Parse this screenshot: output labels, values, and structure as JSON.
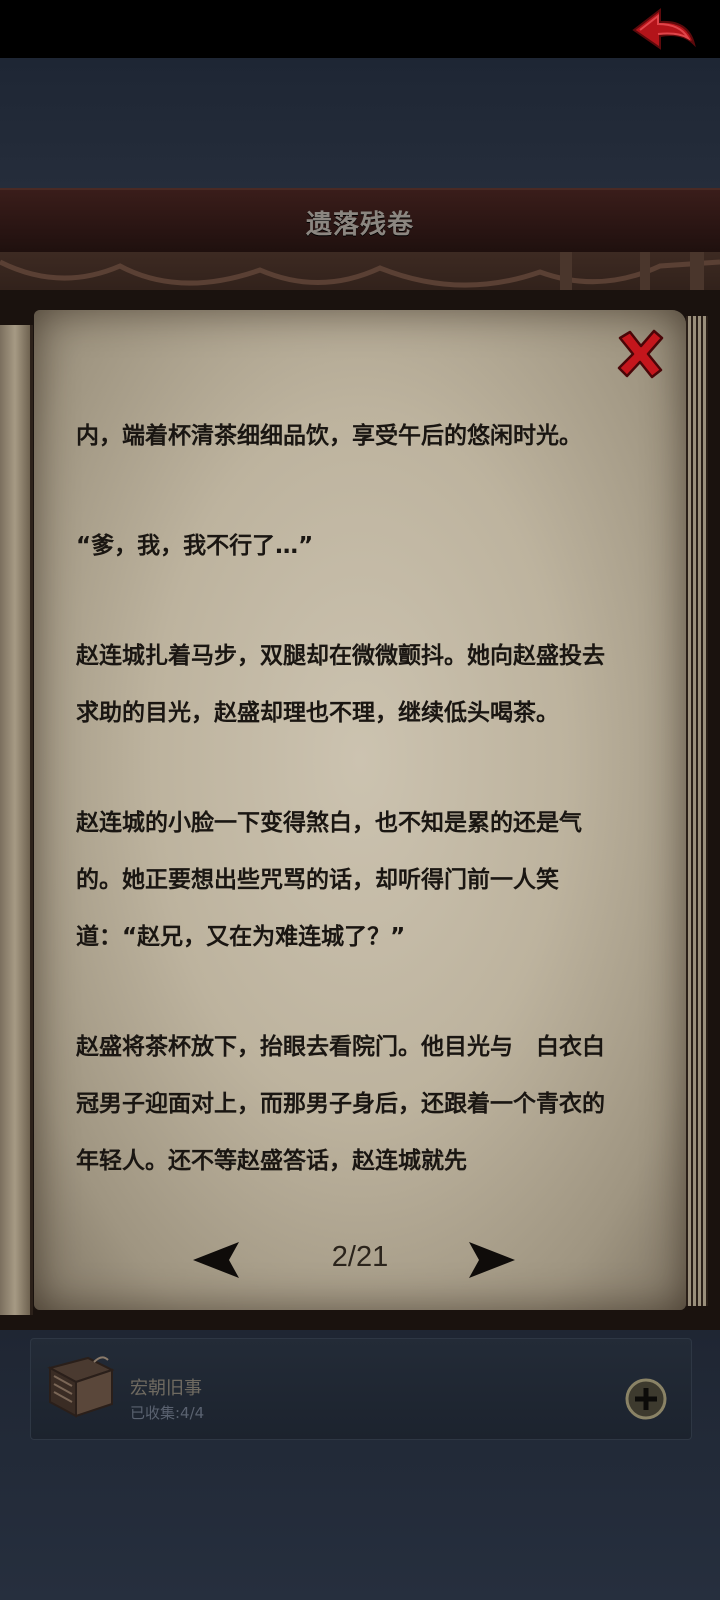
{
  "header": {
    "title": "遗落残卷"
  },
  "reader": {
    "paragraphs": [
      "内，端着杯清茶细细品饮，享受午后的悠闲时光。",
      "“爹，我，我不行了…”",
      "赵连城扎着马步，双腿却在微微颤抖。她向赵盛投去求助的目光，赵盛却理也不理，继续低头喝茶。",
      "赵连城的小脸一下变得煞白，也不知是累的还是气的。她正要想出些咒骂的话，却听得门前一人笑道：“赵兄，又在为难连城了？”",
      "赵盛将茶杯放下，抬眼去看院门。他目光与　白衣白冠男子迎面对上，而那男子身后，还跟着一个青衣的年轻人。还不等赵盛答话，赵连城就先"
    ],
    "page_indicator": "2/21"
  },
  "collection": {
    "title": "宏朝旧事",
    "collected_label": "已收集:4/4"
  },
  "colors": {
    "header_bg": "#2a1513",
    "page_bg": "#bdb39e",
    "accent_red": "#c4161c"
  },
  "icons": {
    "back": "back-arrow-icon",
    "close": "close-x-icon",
    "prev": "left-triangle-icon",
    "next": "right-triangle-icon",
    "book": "book-icon",
    "add": "plus-circle-icon"
  }
}
